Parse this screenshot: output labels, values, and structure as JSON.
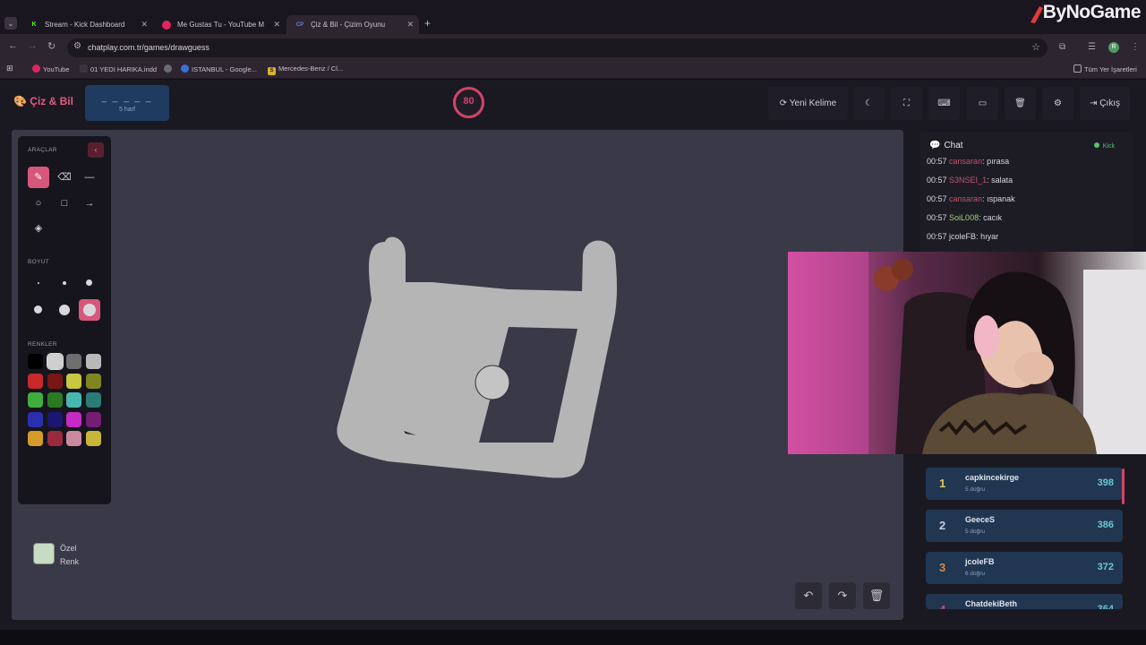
{
  "browser": {
    "tabs": [
      {
        "title": "Stream - Kick Dashboard",
        "favicon": "K",
        "color": "#53fc18"
      },
      {
        "title": "Me Gustas Tu - YouTube M",
        "favicon": "",
        "color": "#e0245e"
      },
      {
        "title": "Çiz & Bil - Çizim Oyunu",
        "favicon": "CP",
        "color": "#6b7cd6"
      }
    ],
    "url": "chatplay.com.tr/games/drawguess",
    "profile_initial": "R",
    "bookmarks": [
      "YouTube",
      "01 YEDI HARIKA.indd",
      "",
      "ISTANBUL - Google...",
      "Mercedes-Benz / Cl...",
      "Tüm Yer İşaretleri"
    ],
    "watermark": "ByNoGame"
  },
  "header": {
    "logo": "Çiz & Bil",
    "word_blanks": "_ _ _ _ _",
    "word_length": "5 harf",
    "timer": "80",
    "new_word": "Yeni Kelime",
    "exit": "Çıkış"
  },
  "tools": {
    "title": "ARAÇLAR",
    "size_label": "BOYUT",
    "colors_label": "RENKLER",
    "custom_color_line1": "Özel",
    "custom_color_line2": "Renk",
    "palette": [
      "#000000",
      "#cfcfcf",
      "#6e6e6e",
      "#b9b9b9",
      "#c62a2a",
      "#7a1616",
      "#c9c640",
      "#80861f",
      "#3fae3f",
      "#2a7a22",
      "#47b8b0",
      "#2a7c76",
      "#2a2fb0",
      "#1c1670",
      "#c42ac4",
      "#741d74",
      "#d49a2a",
      "#9a2a3e",
      "#c98aa0",
      "#c8b53a"
    ],
    "accent": "#d7577a"
  },
  "chat": {
    "title": "Chat",
    "platform": "Kick",
    "messages": [
      {
        "time": "00:57",
        "user": "cansaran",
        "text": "pırasa",
        "color": "#c6526b"
      },
      {
        "time": "00:57",
        "user": "S3NSEI_1",
        "text": "salata",
        "color": "#c6526b"
      },
      {
        "time": "00:57",
        "user": "cansaran",
        "text": "ıspanak",
        "color": "#c6526b"
      },
      {
        "time": "00:57",
        "user": "SoiL008",
        "text": "cacık",
        "color": "#9fd27a"
      },
      {
        "time": "00:57",
        "user": "jcoleFB",
        "text": "hıyar",
        "color": "#d7d7de"
      }
    ]
  },
  "leaderboard": [
    {
      "rank": "1",
      "name": "capkincekirge",
      "sub": "5 doğru",
      "score": "398",
      "rank_color": "#e0c55a"
    },
    {
      "rank": "2",
      "name": "GeeceS",
      "sub": "5 doğru",
      "score": "386",
      "rank_color": "#c8ccd4"
    },
    {
      "rank": "3",
      "name": "jcoleFB",
      "sub": "6 doğru",
      "score": "372",
      "rank_color": "#d08a4a"
    },
    {
      "rank": "4",
      "name": "ChatdekiBeth",
      "sub": "",
      "score": "364",
      "rank_color": "#d14468"
    }
  ],
  "timer_progress": 1.0
}
